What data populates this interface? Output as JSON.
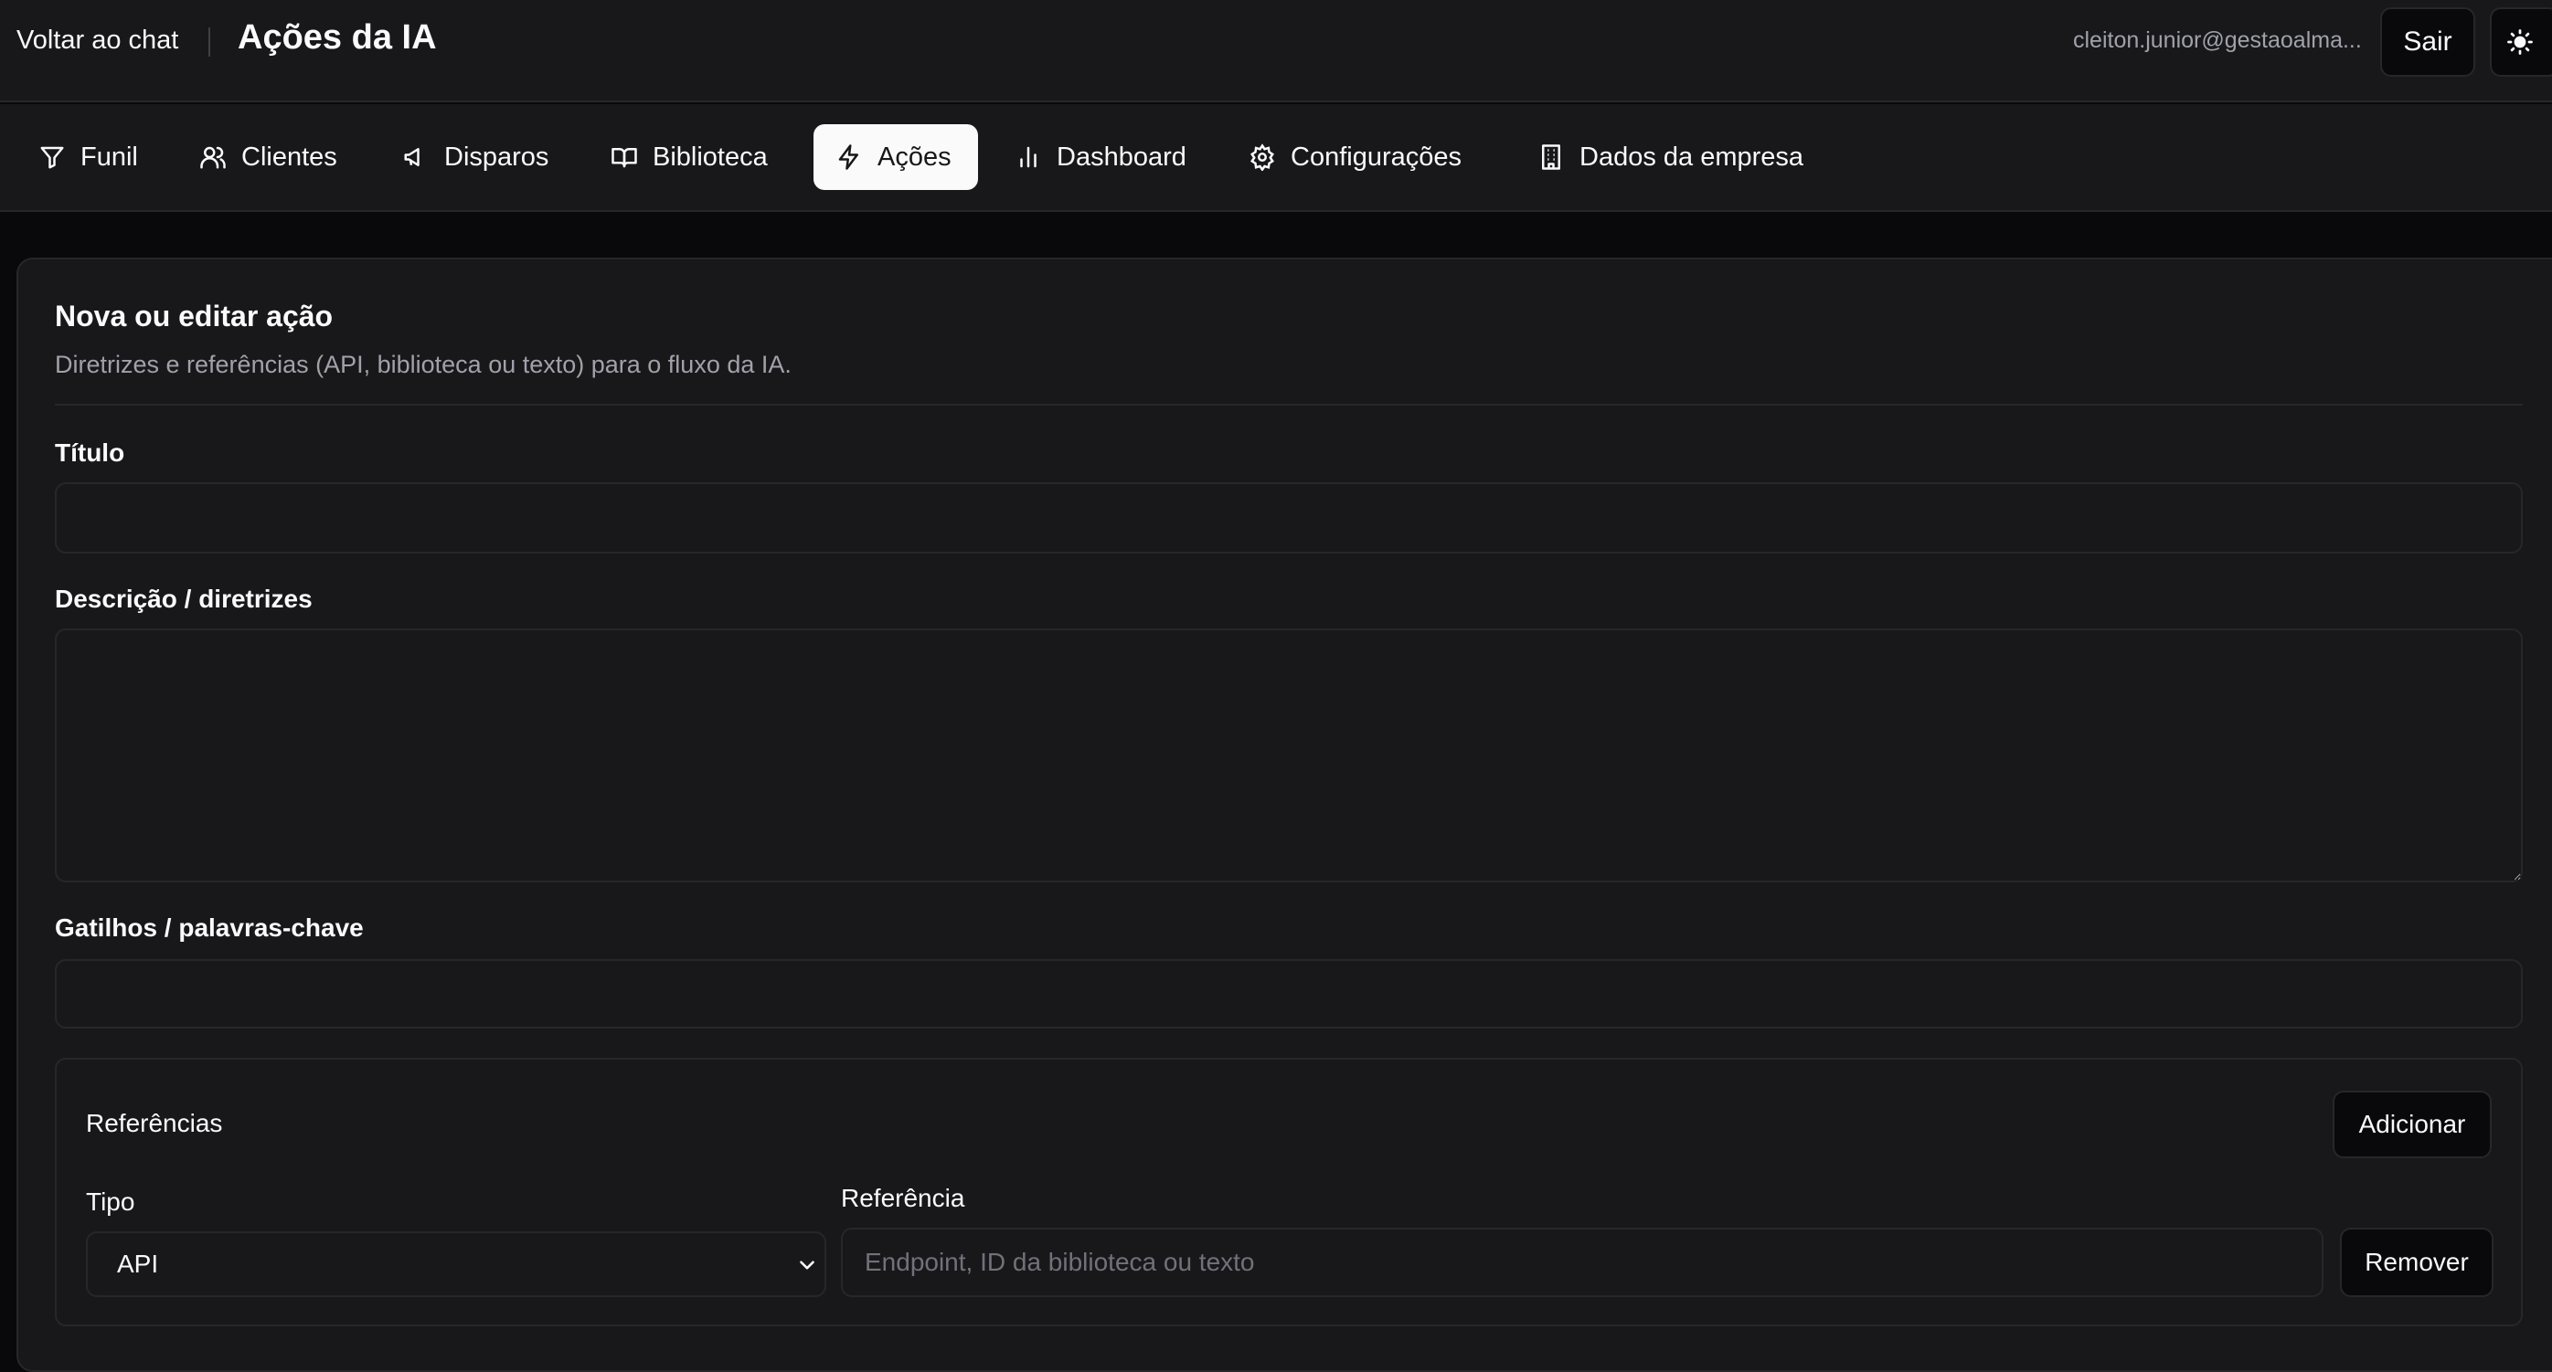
{
  "header": {
    "back_label": "Voltar ao chat",
    "title": "Ações da IA",
    "user_email": "cleiton.junior@gestaoalma...",
    "logout_label": "Sair",
    "theme_icon": "sun-icon"
  },
  "nav": {
    "items": [
      {
        "label": "Funil",
        "icon": "filter-icon"
      },
      {
        "label": "Clientes",
        "icon": "users-icon"
      },
      {
        "label": "Disparos",
        "icon": "megaphone-icon"
      },
      {
        "label": "Biblioteca",
        "icon": "book-open-icon"
      },
      {
        "label": "Ações",
        "icon": "zap-icon",
        "active": true
      },
      {
        "label": "Dashboard",
        "icon": "bar-chart-icon"
      },
      {
        "label": "Configurações",
        "icon": "gear-icon"
      },
      {
        "label": "Dados da empresa",
        "icon": "building-icon"
      }
    ]
  },
  "form": {
    "title": "Nova ou editar ação",
    "subtitle": "Diretrizes e referências (API, biblioteca ou texto) para o fluxo da IA.",
    "title_label": "Título",
    "title_value": "",
    "description_label": "Descrição / diretrizes",
    "description_value": "",
    "triggers_label": "Gatilhos / palavras-chave",
    "triggers_value": ""
  },
  "references": {
    "title": "Referências",
    "add_label": "Adicionar",
    "type_label": "Tipo",
    "type_value": "API",
    "reference_label": "Referência",
    "reference_placeholder": "Endpoint, ID da biblioteca ou texto",
    "reference_value": "",
    "remove_label": "Remover"
  }
}
